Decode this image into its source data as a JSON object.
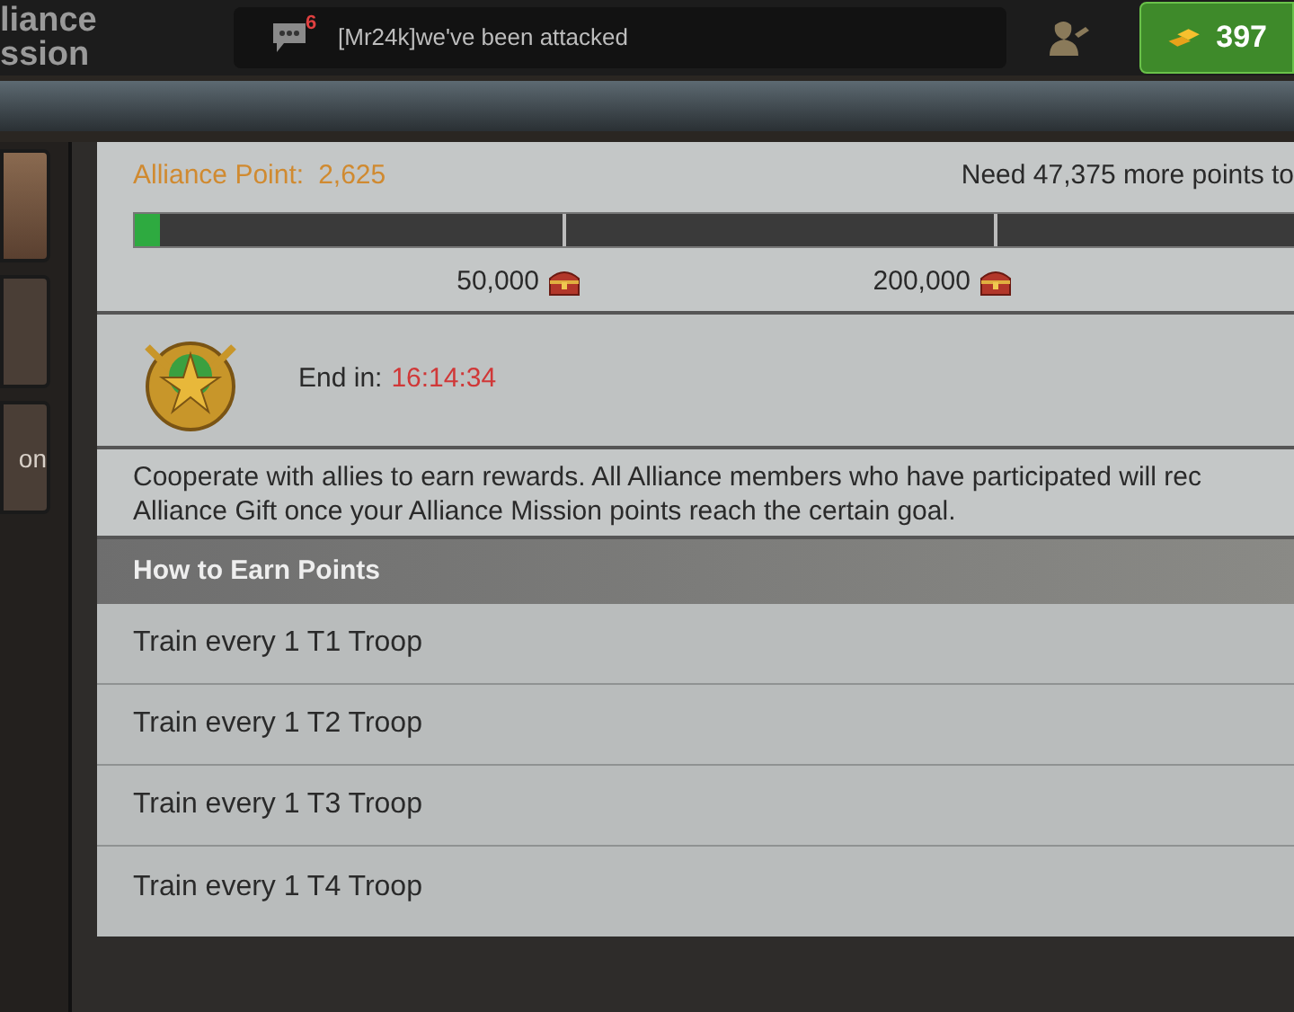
{
  "header": {
    "title_lines": [
      "liance",
      "ssion"
    ],
    "chat": {
      "badge": "6",
      "message": "[Mr24k]we've been attacked"
    },
    "gold": {
      "amount": "397"
    }
  },
  "side_tabs": [
    {
      "selected": true
    },
    {
      "selected": false
    },
    {
      "label": "on",
      "selected": false
    }
  ],
  "points": {
    "label": "Alliance Point:",
    "value": "2,625",
    "need": "Need 47,375 more points to",
    "level": 0.02,
    "milestones": [
      "50,000",
      "200,000"
    ]
  },
  "timer": {
    "label": "End in:",
    "value": "16:14:34"
  },
  "description": [
    "Cooperate with allies to earn rewards. All Alliance members who have participated will rec",
    "Alliance Gift once your Alliance Mission points reach the certain goal."
  ],
  "earn": {
    "title": "How to Earn Points",
    "rows": [
      "Train every 1 T1 Troop",
      "Train every 1 T2 Troop",
      "Train every 1 T3 Troop",
      "Train every 1 T4 Troop"
    ]
  }
}
